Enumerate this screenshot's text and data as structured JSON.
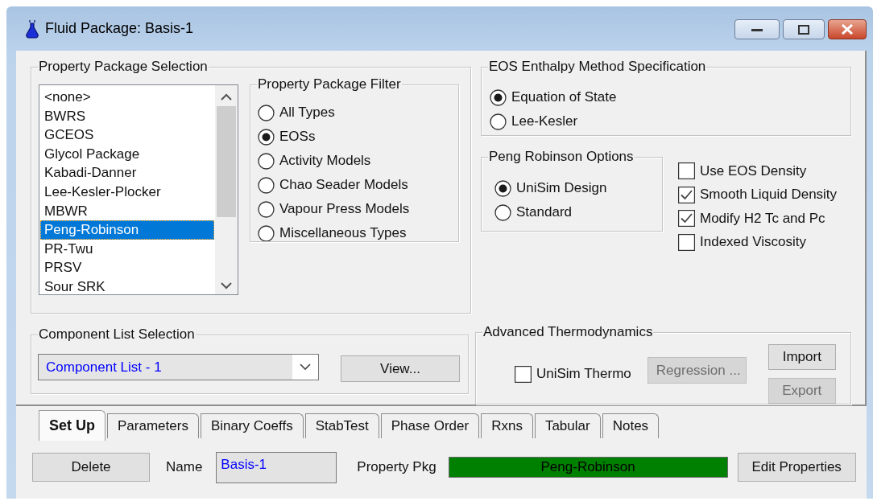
{
  "window": {
    "title": "Fluid Package: Basis-1"
  },
  "property_package_selection": {
    "title": "Property Package Selection",
    "items": [
      {
        "label": "<none>",
        "selected": false
      },
      {
        "label": "BWRS",
        "selected": false
      },
      {
        "label": "GCEOS",
        "selected": false
      },
      {
        "label": "Glycol Package",
        "selected": false
      },
      {
        "label": "Kabadi-Danner",
        "selected": false
      },
      {
        "label": "Lee-Kesler-Plocker",
        "selected": false
      },
      {
        "label": "MBWR",
        "selected": false
      },
      {
        "label": "Peng-Robinson",
        "selected": true
      },
      {
        "label": "PR-Twu",
        "selected": false
      },
      {
        "label": "PRSV",
        "selected": false
      },
      {
        "label": "Sour SRK",
        "selected": false
      }
    ]
  },
  "property_package_filter": {
    "title": "Property Package Filter",
    "options": [
      {
        "label": "All Types",
        "selected": false
      },
      {
        "label": "EOSs",
        "selected": true
      },
      {
        "label": "Activity Models",
        "selected": false
      },
      {
        "label": "Chao Seader Models",
        "selected": false
      },
      {
        "label": "Vapour Press Models",
        "selected": false
      },
      {
        "label": "Miscellaneous Types",
        "selected": false
      }
    ]
  },
  "eos_enthalpy_method": {
    "title": "EOS Enthalpy Method Specification",
    "options": [
      {
        "label": "Equation of State",
        "selected": true
      },
      {
        "label": "Lee-Kesler",
        "selected": false
      }
    ]
  },
  "peng_robinson_options": {
    "title": "Peng Robinson Options",
    "options": [
      {
        "label": "UniSim Design",
        "selected": true
      },
      {
        "label": "Standard",
        "selected": false
      }
    ]
  },
  "density_options": [
    {
      "label": "Use EOS Density",
      "checked": false
    },
    {
      "label": "Smooth Liquid Density",
      "checked": true
    },
    {
      "label": "Modify H2 Tc and Pc",
      "checked": true
    },
    {
      "label": "Indexed Viscosity",
      "checked": false
    }
  ],
  "component_list_selection": {
    "title": "Component List Selection",
    "value": "Component List - 1",
    "view_button": "View..."
  },
  "advanced_thermodynamics": {
    "title": "Advanced Thermodynamics",
    "unisim_thermo": {
      "label": "UniSim Thermo",
      "checked": false
    },
    "buttons": [
      {
        "label": "Regression ...",
        "disabled": true
      },
      {
        "label": "Import",
        "disabled": false
      },
      {
        "label": "Export",
        "disabled": true
      }
    ]
  },
  "tabs": [
    {
      "label": "Set Up",
      "selected": true
    },
    {
      "label": "Parameters",
      "selected": false
    },
    {
      "label": "Binary Coeffs",
      "selected": false
    },
    {
      "label": "StabTest",
      "selected": false
    },
    {
      "label": "Phase Order",
      "selected": false
    },
    {
      "label": "Rxns",
      "selected": false
    },
    {
      "label": "Tabular",
      "selected": false
    },
    {
      "label": "Notes",
      "selected": false
    }
  ],
  "footer": {
    "delete_button": "Delete",
    "name_label": "Name",
    "name_value": "Basis-1",
    "property_pkg_label": "Property Pkg",
    "property_pkg_value": "Peng-Robinson",
    "edit_button": "Edit Properties"
  }
}
